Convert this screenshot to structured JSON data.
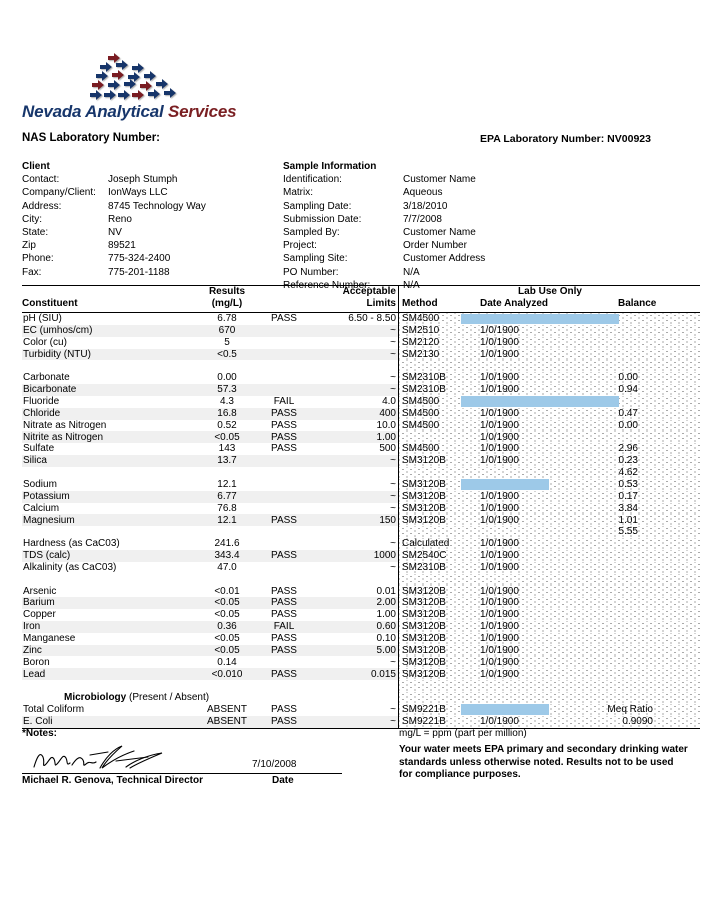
{
  "logo": {
    "name_part1": "Nevada Analytical",
    "name_part2": " Services",
    "navy": "#17366b",
    "red": "#7a1f22"
  },
  "header": {
    "nas_label": "NAS Laboratory Number:",
    "epa_label": "EPA Laboratory Number: NV00923"
  },
  "client": {
    "heading": "Client",
    "rows": [
      {
        "label": "Contact:",
        "value": "Joseph Stumph"
      },
      {
        "label": "Company/Client:",
        "value": "IonWays LLC"
      },
      {
        "label": "Address:",
        "value": "8745 Technology Way"
      },
      {
        "label": "City:",
        "value": "Reno"
      },
      {
        "label": "State:",
        "value": "NV"
      },
      {
        "label": "Zip",
        "value": "89521"
      },
      {
        "label": "Phone:",
        "value": "775-324-2400"
      },
      {
        "label": "Fax:",
        "value": "775-201-1188"
      }
    ]
  },
  "sample": {
    "heading": "Sample Information",
    "rows": [
      {
        "label": "Identification:",
        "value": "Customer Name"
      },
      {
        "label": "Matrix:",
        "value": "Aqueous"
      },
      {
        "label": "Sampling Date:",
        "value": "3/18/2010"
      },
      {
        "label": "Submission Date:",
        "value": "7/7/2008"
      },
      {
        "label": "Sampled By:",
        "value": "Customer Name"
      },
      {
        "label": "Project:",
        "value": "Order Number"
      },
      {
        "label": "Sampling Site:",
        "value": "Customer Address"
      },
      {
        "label": "PO Number:",
        "value": "N/A"
      },
      {
        "label": "Reference Number:",
        "value": "N/A"
      }
    ]
  },
  "table": {
    "headers": {
      "constituent": "Constituent",
      "results_line1": "Results",
      "results_line2": "(mg/L)",
      "limits_line1": "Acceptable",
      "limits_line2": "Limits",
      "lab_use_only": "Lab Use Only",
      "method": "Method",
      "date_analyzed": "Date Analyzed",
      "balance": "Balance"
    },
    "rows": [
      {
        "name": "pH (SIU)",
        "result": "6.78",
        "pf": "PASS",
        "limit": "6.50 - 8.50",
        "method": "SM4500",
        "date": "",
        "balance": "",
        "highlight": "long"
      },
      {
        "name": "EC (umhos/cm)",
        "result": "670",
        "pf": "",
        "limit": "~",
        "method": "SM2510",
        "date": "1/0/1900",
        "balance": ""
      },
      {
        "name": "Color (cu)",
        "result": "5",
        "pf": "",
        "limit": "~",
        "method": "SM2120",
        "date": "1/0/1900",
        "balance": ""
      },
      {
        "name": "Turbidity (NTU)",
        "result": "<0.5",
        "pf": "",
        "limit": "~",
        "method": "SM2130",
        "date": "1/0/1900",
        "balance": ""
      },
      {
        "spacer": true
      },
      {
        "name": "Carbonate",
        "result": "0.00",
        "pf": "",
        "limit": "~",
        "method": "SM2310B",
        "date": "1/0/1900",
        "balance": "0.00"
      },
      {
        "name": "Bicarbonate",
        "result": "57.3",
        "pf": "",
        "limit": "~",
        "method": "SM2310B",
        "date": "1/0/1900",
        "balance": "0.94"
      },
      {
        "name": "Fluoride",
        "result": "4.3",
        "pf": "FAIL",
        "limit": "4.0",
        "method": "SM4500",
        "date": "",
        "balance": "",
        "highlight": "long"
      },
      {
        "name": "Chloride",
        "result": "16.8",
        "pf": "PASS",
        "limit": "400",
        "method": "SM4500",
        "date": "1/0/1900",
        "balance": "0.47"
      },
      {
        "name": "Nitrate as Nitrogen",
        "result": "0.52",
        "pf": "PASS",
        "limit": "10.0",
        "method": "SM4500",
        "date": "1/0/1900",
        "balance": "0.00"
      },
      {
        "name": "Nitrite as Nitrogen",
        "result": "<0.05",
        "pf": "PASS",
        "limit": "1.00",
        "method": "",
        "date": "1/0/1900",
        "balance": ""
      },
      {
        "name": "Sulfate",
        "result": "143",
        "pf": "PASS",
        "limit": "500",
        "method": "SM4500",
        "date": "1/0/1900",
        "balance": "2.96"
      },
      {
        "name": "Silica",
        "result": "13.7",
        "pf": "",
        "limit": "~",
        "method": "SM3120B",
        "date": "1/0/1900",
        "balance": "0.23"
      },
      {
        "spacer": true,
        "balance": "4.62"
      },
      {
        "name": "Sodium",
        "result": "12.1",
        "pf": "",
        "limit": "~",
        "method": "SM3120B",
        "date": "",
        "balance": "0.53",
        "highlight": "short"
      },
      {
        "name": "Potassium",
        "result": "6.77",
        "pf": "",
        "limit": "~",
        "method": "SM3120B",
        "date": "1/0/1900",
        "balance": "0.17"
      },
      {
        "name": "Calcium",
        "result": "76.8",
        "pf": "",
        "limit": "~",
        "method": "SM3120B",
        "date": "1/0/1900",
        "balance": "3.84"
      },
      {
        "name": "Magnesium",
        "result": "12.1",
        "pf": "PASS",
        "limit": "150",
        "method": "SM3120B",
        "date": "1/0/1900",
        "balance": "1.01"
      },
      {
        "spacer": true,
        "balance": "5.55"
      },
      {
        "name": "Hardness (as CaC03)",
        "result": "241.6",
        "pf": "",
        "limit": "~",
        "method": "Calculated",
        "date": "1/0/1900",
        "balance": ""
      },
      {
        "name": "TDS (calc)",
        "result": "343.4",
        "pf": "PASS",
        "limit": "1000",
        "method": "SM2540C",
        "date": "1/0/1900",
        "balance": ""
      },
      {
        "name": "Alkalinity (as CaC03)",
        "result": "47.0",
        "pf": "",
        "limit": "~",
        "method": "SM2310B",
        "date": "1/0/1900",
        "balance": ""
      },
      {
        "spacer": true
      },
      {
        "name": "Arsenic",
        "result": "<0.01",
        "pf": "PASS",
        "limit": "0.01",
        "method": "SM3120B",
        "date": "1/0/1900",
        "balance": ""
      },
      {
        "name": "Barium",
        "result": "<0.05",
        "pf": "PASS",
        "limit": "2.00",
        "method": "SM3120B",
        "date": "1/0/1900",
        "balance": ""
      },
      {
        "name": "Copper",
        "result": "<0.05",
        "pf": "PASS",
        "limit": "1.00",
        "method": "SM3120B",
        "date": "1/0/1900",
        "balance": ""
      },
      {
        "name": "Iron",
        "result": "0.36",
        "pf": "FAIL",
        "limit": "0.60",
        "method": "SM3120B",
        "date": "1/0/1900",
        "balance": ""
      },
      {
        "name": "Manganese",
        "result": "<0.05",
        "pf": "PASS",
        "limit": "0.10",
        "method": "SM3120B",
        "date": "1/0/1900",
        "balance": ""
      },
      {
        "name": "Zinc",
        "result": "<0.05",
        "pf": "PASS",
        "limit": "5.00",
        "method": "SM3120B",
        "date": "1/0/1900",
        "balance": ""
      },
      {
        "name": "Boron",
        "result": "0.14",
        "pf": "",
        "limit": "~",
        "method": "SM3120B",
        "date": "1/0/1900",
        "balance": ""
      },
      {
        "name": "Lead",
        "result": "<0.010",
        "pf": "PASS",
        "limit": "0.015",
        "method": "SM3120B",
        "date": "1/0/1900",
        "balance": ""
      },
      {
        "spacer": true
      },
      {
        "name": "Microbiology (Present / Absent)",
        "section": true,
        "result": "",
        "pf": "",
        "limit": "",
        "method": "",
        "date": "",
        "balance": ""
      },
      {
        "name": "Total Coliform",
        "result": "ABSENT",
        "pf": "PASS",
        "limit": "~",
        "method": "SM9221B",
        "date": "",
        "balance": "Meq Ratio",
        "balance_wide": true,
        "highlight": "short"
      },
      {
        "name": "E. Coli",
        "result": "ABSENT",
        "pf": "PASS",
        "limit": "~",
        "method": "SM9221B",
        "date": "1/0/1900",
        "balance": "0.9090",
        "balance_wide": true
      }
    ]
  },
  "footer": {
    "notes_label": "*Notes:",
    "mgl_note": "mg/L = ppm (part per million)",
    "signature_date": "7/10/2008",
    "signature_name": "Michael R. Genova, Technical Director",
    "date_label": "Date",
    "disclaimer": "Your water meets EPA primary and secondary drinking water standards unless otherwise noted. Results not to be used for compliance purposes."
  },
  "colors": {
    "highlight_blue": "#9dc9e8",
    "row_stripe": "#f0f0f0"
  }
}
